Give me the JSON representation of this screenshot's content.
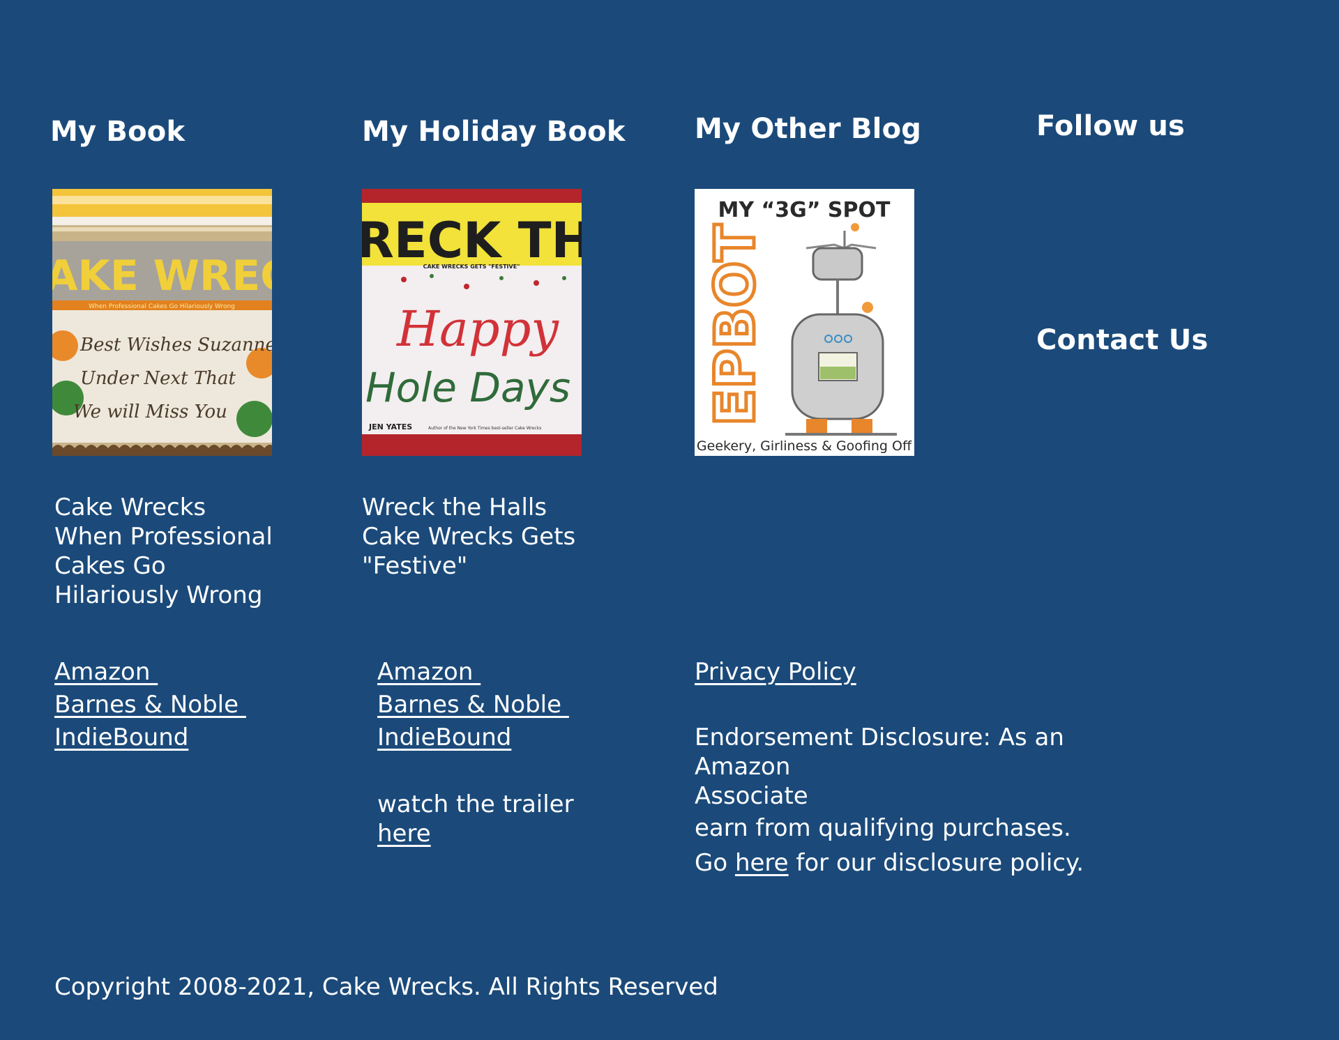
{
  "columns": {
    "my_book": {
      "heading": "My Book",
      "cover": {
        "title": "AKE WRECK",
        "subtitle": "When Professional Cakes Go Hilariously Wrong",
        "lines": [
          "Best Wishes Suzanne",
          "Under Next That",
          "We will Miss You"
        ]
      },
      "description": "Cake Wrecks When Professional Cakes Go Hilariously Wrong",
      "links": [
        "Amazon ",
        "Barnes & Noble ",
        "IndieBound"
      ]
    },
    "holiday_book": {
      "heading": "My Holiday Book",
      "cover": {
        "title": "RECK THE HAL",
        "tag": "CAKE WRECKS GETS \"FESTIVE\"",
        "line1": "Happy",
        "line2": "Hole Days",
        "author": "JEN YATES",
        "author_note": "Author of the New York Times best-seller Cake Wrecks"
      },
      "description_lines": [
        "Wreck the Halls",
        "Cake Wrecks Gets",
        "\"Festive\""
      ],
      "links": [
        "Amazon ",
        "Barnes & Noble ",
        "IndieBound"
      ],
      "trailer_text": "watch the trailer",
      "trailer_link": "here"
    },
    "other_blog": {
      "heading": "My Other Blog",
      "cover": {
        "top": "MY “3G” SPOT",
        "side": "EPBOT",
        "bottom": "Geekery, Girliness & Goofing Off"
      },
      "privacy_link": "Privacy Policy",
      "disclosure_line1": "Endorsement Disclosure: As an Amazon",
      "disclosure_line2": "Associate",
      "disclosure_line3": "earn from qualifying purchases.",
      "policy_prefix": "Go ",
      "policy_link": "here",
      "policy_suffix": " for our disclosure policy."
    },
    "follow": {
      "heading": "Follow us",
      "contact": "Contact Us"
    }
  },
  "copyright": "Copyright 2008-2021, Cake Wrecks. All Rights Reserved",
  "colors": {
    "background": "#1b4a7a",
    "text": "#ffffff"
  }
}
